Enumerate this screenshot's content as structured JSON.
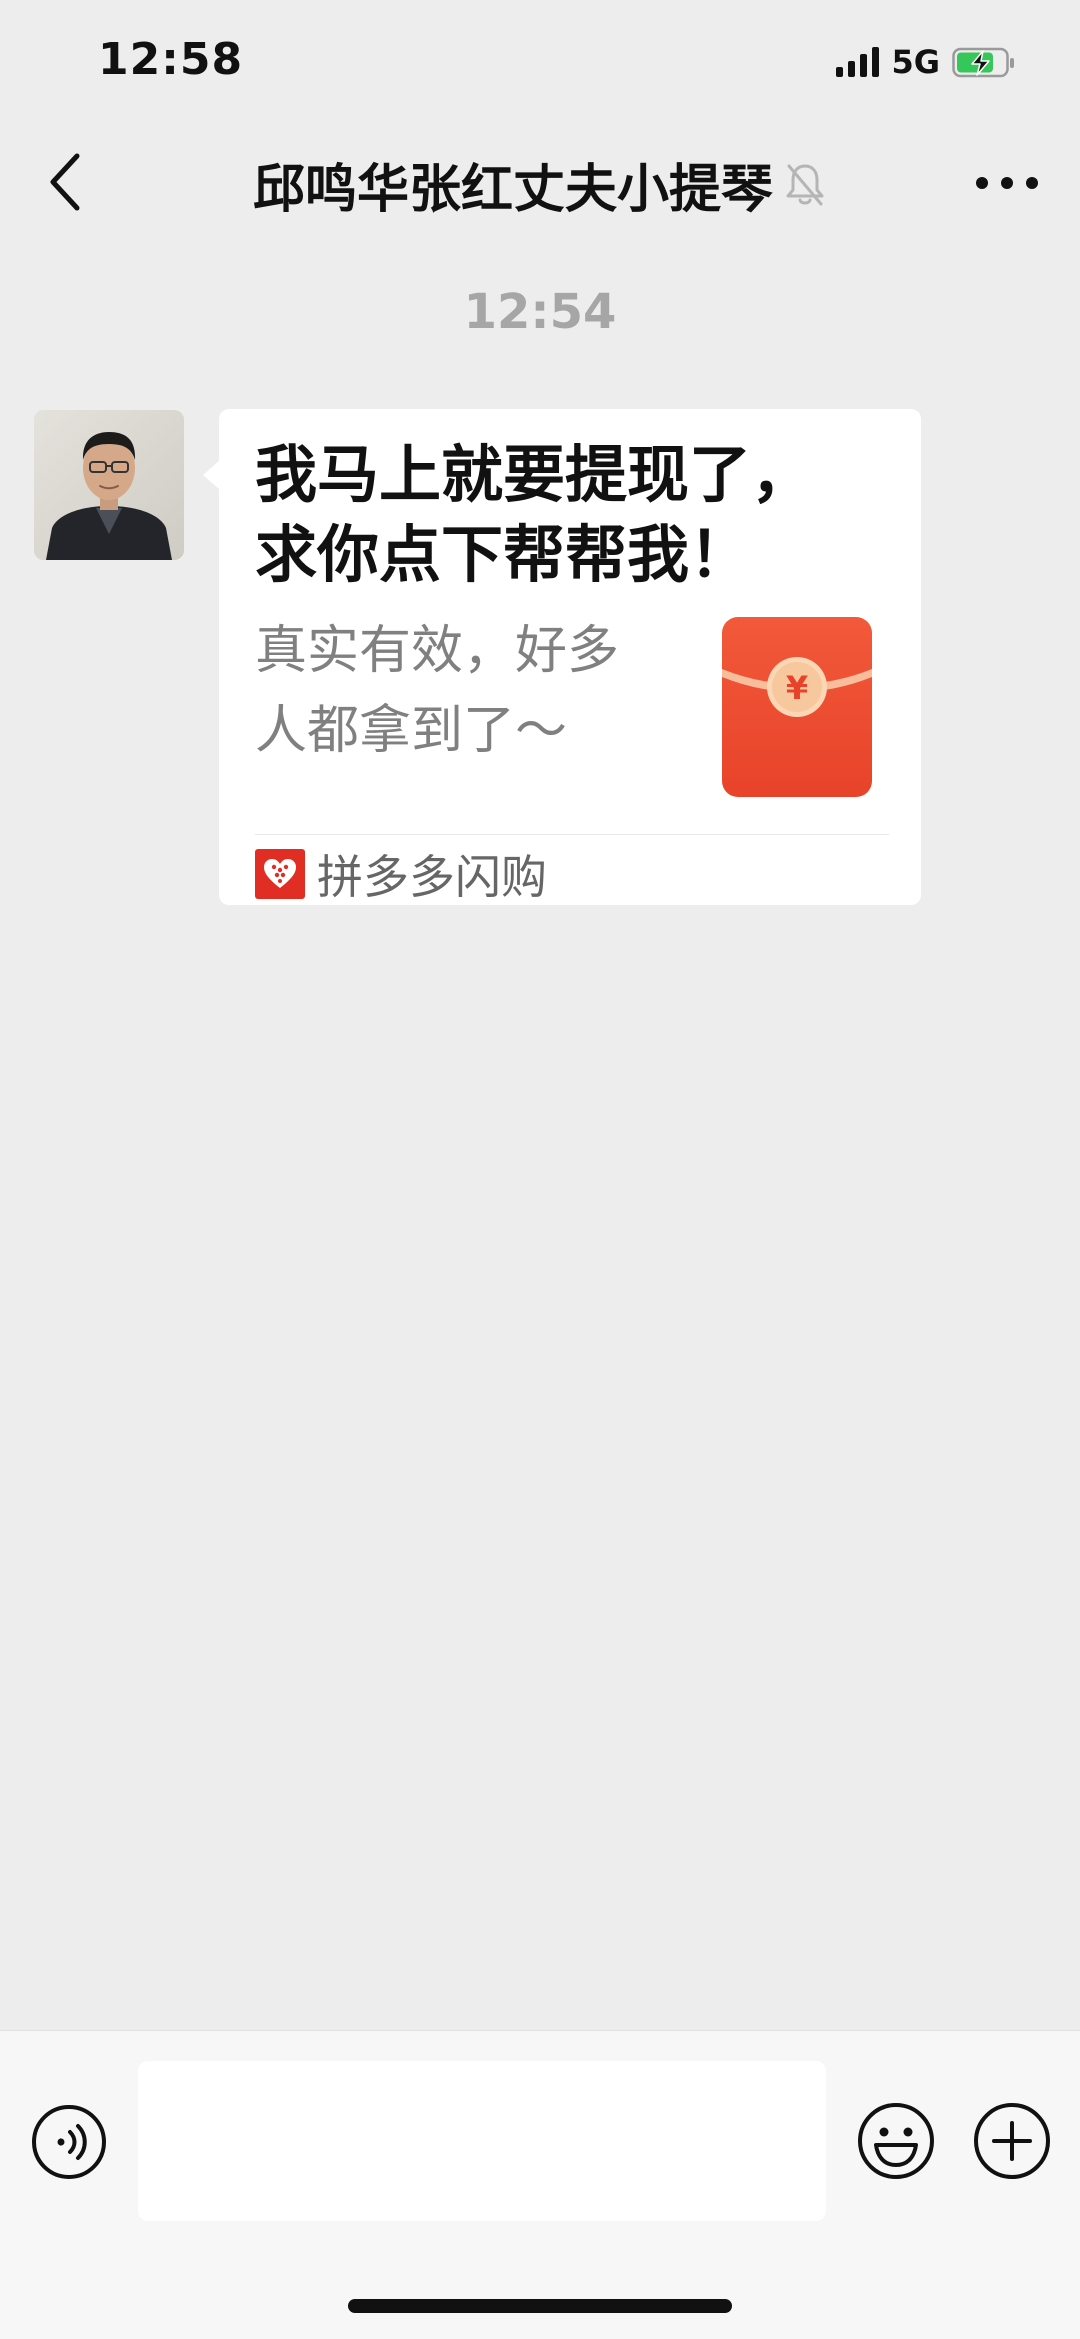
{
  "status_bar": {
    "time": "12:58",
    "network": "5G",
    "battery_charging": true,
    "signal_bars": 4
  },
  "nav": {
    "title": "邱鸣华张红丈夫小提琴",
    "muted": true,
    "back_icon": "chevron-left-icon",
    "more_icon": "ellipsis-icon"
  },
  "chat": {
    "timestamp": "12:54",
    "messages": [
      {
        "type": "link-card",
        "sender": "other",
        "title_line1": "我马上就要提现了，",
        "title_line2": "求你点下帮帮我！",
        "desc_line1": "真实有效，好多",
        "desc_line2": "人都拿到了～",
        "thumbnail_icon": "red-envelope-icon",
        "source_name": "拼多多闪购",
        "source_icon": "pinduoduo-logo-icon"
      }
    ]
  },
  "input_bar": {
    "placeholder": "",
    "voice_icon": "voice-icon",
    "emoji_icon": "emoji-icon",
    "plus_icon": "plus-icon"
  },
  "colors": {
    "background": "#ededed",
    "bubble": "#ffffff",
    "envelope_red": "#f04a2a",
    "pdd_red": "#e02e24",
    "timestamp_gray": "#a6a6a6"
  }
}
